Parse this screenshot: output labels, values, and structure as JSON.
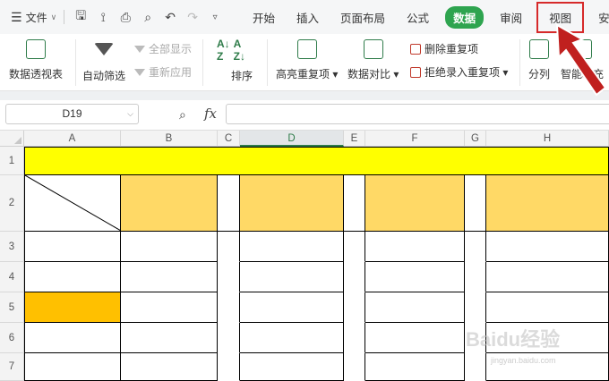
{
  "menu": {
    "file_label": "文件",
    "quick_icons": [
      "save-icon",
      "format-painter-icon",
      "print-icon",
      "print-preview-icon",
      "undo-icon",
      "redo-icon",
      "more-icon"
    ],
    "tabs": [
      "开始",
      "插入",
      "页面布局",
      "公式",
      "数据",
      "审阅",
      "视图",
      "安全"
    ],
    "active_tab": "数据",
    "highlighted_tab": "视图"
  },
  "ribbon": {
    "pivot": "数据透视表",
    "autofilter": "自动筛选",
    "show_all": "全部显示",
    "reapply": "重新应用",
    "sort": "排序",
    "highlight_dup": "高亮重复项",
    "compare": "数据对比",
    "remove_dup": "删除重复项",
    "reject_dup": "拒绝录入重复项",
    "split": "分列",
    "smart_fill": "智能填充"
  },
  "formula_bar": {
    "name_box": "D19",
    "fx": "fx",
    "value": ""
  },
  "grid": {
    "columns": [
      "A",
      "B",
      "C",
      "D",
      "E",
      "F",
      "G",
      "H"
    ],
    "selected_column": "D",
    "rows": [
      "1",
      "2",
      "3",
      "4",
      "5",
      "6",
      "7"
    ]
  },
  "colors": {
    "accent_green": "#2ea44f",
    "row1_fill": "#ffff00",
    "header_fill": "#ffd966",
    "a5_fill": "#ffc000",
    "annotation_red": "#d62a2a"
  },
  "watermark": {
    "logo": "Baidu经验",
    "url": "jingyan.baidu.com"
  }
}
